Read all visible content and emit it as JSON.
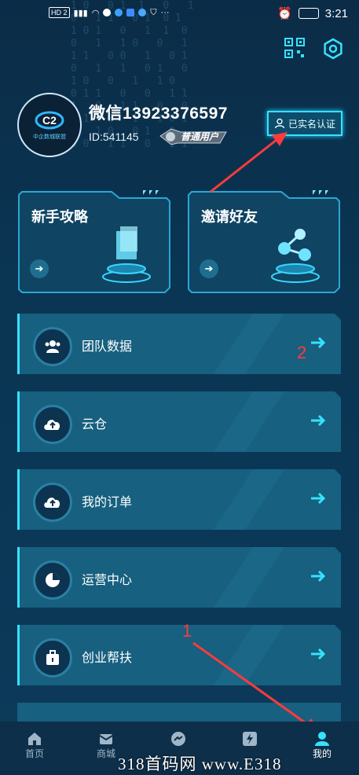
{
  "status_bar": {
    "left_text": "HD 2",
    "time": "3:21",
    "icons": [
      "signal-icon",
      "wifi-icon",
      "chat-icon",
      "cloud-icon",
      "search-app-icon",
      "messenger-icon",
      "shield-icon",
      "alarm-icon",
      "battery-icon"
    ]
  },
  "header": {
    "icons": [
      "qr-code-icon",
      "settings-icon"
    ]
  },
  "profile": {
    "name": "微信13923376597",
    "id_text": "ID:541145",
    "level_badge": "普通用户",
    "verify_badge": "已实名认证",
    "avatar_caption": "中企数城联盟"
  },
  "feature_cards": [
    {
      "title": "新手攻略",
      "icon": "document-hologram-icon"
    },
    {
      "title": "邀请好友",
      "icon": "network-hologram-icon"
    }
  ],
  "menu": [
    {
      "label": "团队数据",
      "icon": "team-icon"
    },
    {
      "label": "云仓",
      "icon": "cloud-upload-icon"
    },
    {
      "label": "我的订单",
      "icon": "cloud-upload-icon"
    },
    {
      "label": "运营中心",
      "icon": "pie-chart-icon"
    },
    {
      "label": "创业帮扶",
      "icon": "briefcase-icon"
    }
  ],
  "annotations": {
    "one": "1",
    "two": "2"
  },
  "tabbar": [
    {
      "label": "首页",
      "icon": "home-icon"
    },
    {
      "label": "商城",
      "icon": "mail-icon"
    },
    {
      "label": "",
      "icon": "messenger-icon"
    },
    {
      "label": "",
      "icon": "lightning-icon"
    },
    {
      "label": "我的",
      "icon": "user-icon"
    }
  ],
  "watermark": "318首码网  www.E318",
  "colors": {
    "accent": "#36e2ff",
    "background": "#0b2c47",
    "annotation": "#ff3b3b"
  }
}
